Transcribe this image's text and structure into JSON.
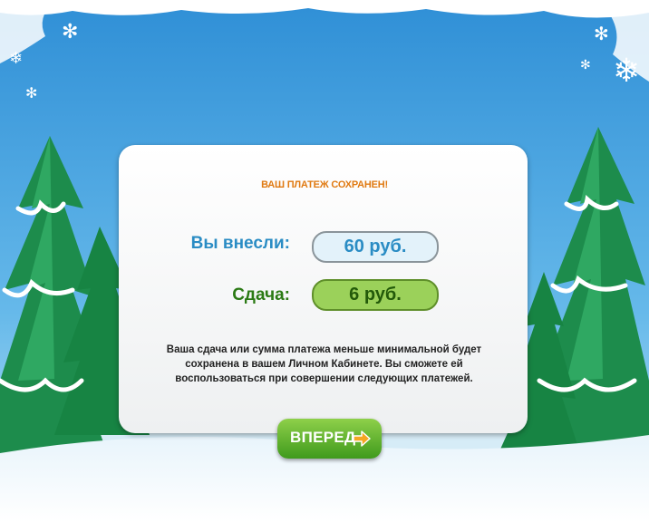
{
  "dialog": {
    "title": "ВАШ ПЛАТЕЖ СОХРАНЕН!",
    "paid_label": "Вы внесли:",
    "paid_value": "60 руб.",
    "change_label": "Сдача:",
    "change_value": "6 руб.",
    "message": "Ваша сдача или сумма платежа меньше минимальной будет сохранена в вашем Личном Кабинете. Вы сможете ей воспользоваться при совершении следующих платежей."
  },
  "buttons": {
    "next_label": "ВПЕРЕД"
  },
  "icons": {
    "next": "arrow-right-icon"
  },
  "colors": {
    "title": "#e07a12",
    "paid": "#2a8cc4",
    "change_text": "#2b7a14",
    "change_fill": "#9bd15a",
    "button": "#4fae23",
    "arrow": "#f5a623"
  }
}
